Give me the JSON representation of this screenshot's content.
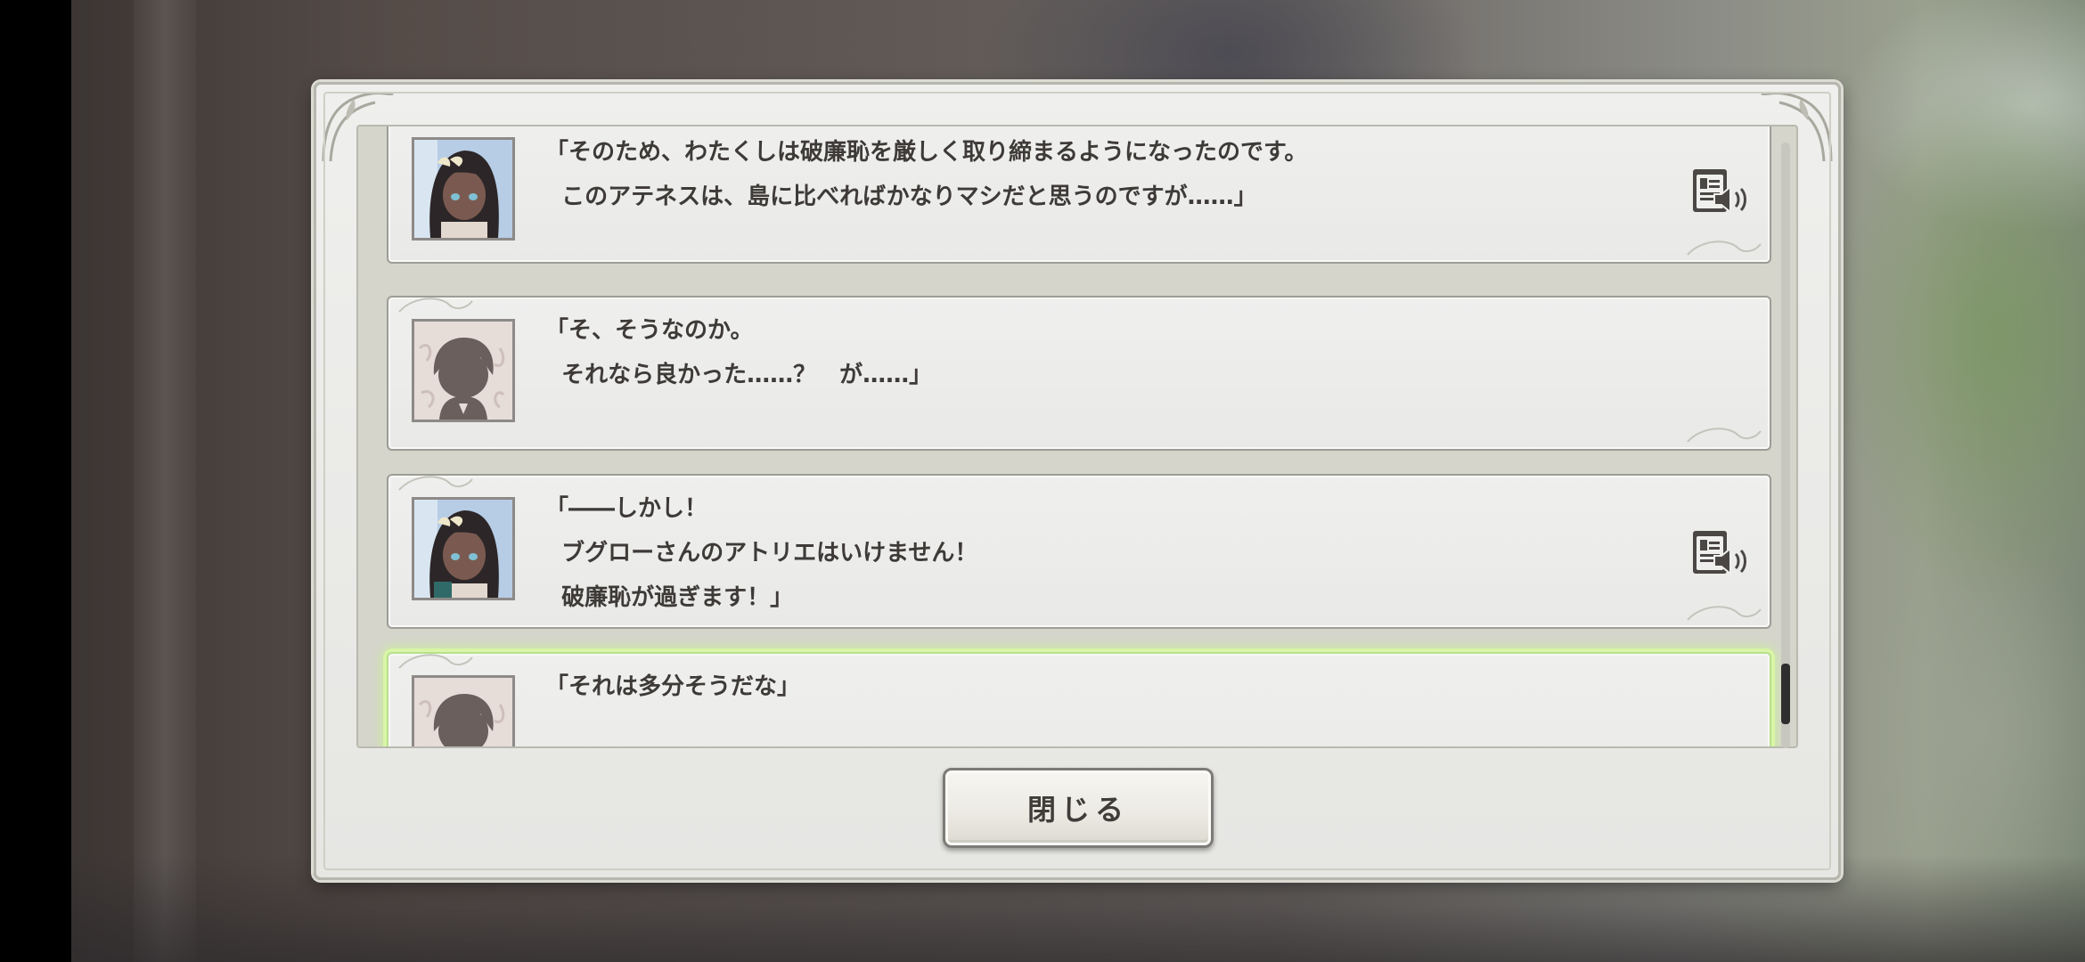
{
  "backlog": {
    "entries": [
      {
        "speaker": "heroine",
        "lines": [
          "「そのため、わたくしは破廉恥を厳しく取り締まるようになったのです。",
          "  このアテネスは、島に比べればかなりマシだと思うのですが……」"
        ],
        "has_voice": true
      },
      {
        "speaker": "protagonist",
        "lines": [
          "「そ、そうなのか。",
          "  それなら良かった……？　が……」"
        ],
        "has_voice": false
      },
      {
        "speaker": "heroine",
        "lines": [
          "「――しかし！",
          "  ブグローさんのアトリエはいけません！",
          "  破廉恥が過ぎます！」"
        ],
        "has_voice": true
      },
      {
        "speaker": "protagonist",
        "lines": [
          "「それは多分そうだな」"
        ],
        "has_voice": false,
        "highlighted": true
      }
    ]
  },
  "icons": {
    "voice": "voice-replay-icon",
    "portrait_heroine": "heroine-portrait",
    "portrait_protagonist": "protagonist-silhouette-portrait"
  },
  "colors": {
    "highlight": "#c8f58c",
    "text": "#3d3a38"
  },
  "close_button": {
    "label": "閉じる"
  }
}
